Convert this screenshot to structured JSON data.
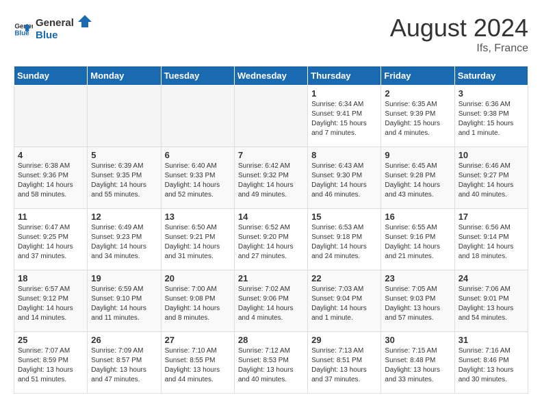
{
  "header": {
    "logo_line1": "General",
    "logo_line2": "Blue",
    "month": "August 2024",
    "location": "Ifs, France"
  },
  "days_of_week": [
    "Sunday",
    "Monday",
    "Tuesday",
    "Wednesday",
    "Thursday",
    "Friday",
    "Saturday"
  ],
  "weeks": [
    [
      {
        "day": "",
        "info": ""
      },
      {
        "day": "",
        "info": ""
      },
      {
        "day": "",
        "info": ""
      },
      {
        "day": "",
        "info": ""
      },
      {
        "day": "1",
        "info": "Sunrise: 6:34 AM\nSunset: 9:41 PM\nDaylight: 15 hours\nand 7 minutes."
      },
      {
        "day": "2",
        "info": "Sunrise: 6:35 AM\nSunset: 9:39 PM\nDaylight: 15 hours\nand 4 minutes."
      },
      {
        "day": "3",
        "info": "Sunrise: 6:36 AM\nSunset: 9:38 PM\nDaylight: 15 hours\nand 1 minute."
      }
    ],
    [
      {
        "day": "4",
        "info": "Sunrise: 6:38 AM\nSunset: 9:36 PM\nDaylight: 14 hours\nand 58 minutes."
      },
      {
        "day": "5",
        "info": "Sunrise: 6:39 AM\nSunset: 9:35 PM\nDaylight: 14 hours\nand 55 minutes."
      },
      {
        "day": "6",
        "info": "Sunrise: 6:40 AM\nSunset: 9:33 PM\nDaylight: 14 hours\nand 52 minutes."
      },
      {
        "day": "7",
        "info": "Sunrise: 6:42 AM\nSunset: 9:32 PM\nDaylight: 14 hours\nand 49 minutes."
      },
      {
        "day": "8",
        "info": "Sunrise: 6:43 AM\nSunset: 9:30 PM\nDaylight: 14 hours\nand 46 minutes."
      },
      {
        "day": "9",
        "info": "Sunrise: 6:45 AM\nSunset: 9:28 PM\nDaylight: 14 hours\nand 43 minutes."
      },
      {
        "day": "10",
        "info": "Sunrise: 6:46 AM\nSunset: 9:27 PM\nDaylight: 14 hours\nand 40 minutes."
      }
    ],
    [
      {
        "day": "11",
        "info": "Sunrise: 6:47 AM\nSunset: 9:25 PM\nDaylight: 14 hours\nand 37 minutes."
      },
      {
        "day": "12",
        "info": "Sunrise: 6:49 AM\nSunset: 9:23 PM\nDaylight: 14 hours\nand 34 minutes."
      },
      {
        "day": "13",
        "info": "Sunrise: 6:50 AM\nSunset: 9:21 PM\nDaylight: 14 hours\nand 31 minutes."
      },
      {
        "day": "14",
        "info": "Sunrise: 6:52 AM\nSunset: 9:20 PM\nDaylight: 14 hours\nand 27 minutes."
      },
      {
        "day": "15",
        "info": "Sunrise: 6:53 AM\nSunset: 9:18 PM\nDaylight: 14 hours\nand 24 minutes."
      },
      {
        "day": "16",
        "info": "Sunrise: 6:55 AM\nSunset: 9:16 PM\nDaylight: 14 hours\nand 21 minutes."
      },
      {
        "day": "17",
        "info": "Sunrise: 6:56 AM\nSunset: 9:14 PM\nDaylight: 14 hours\nand 18 minutes."
      }
    ],
    [
      {
        "day": "18",
        "info": "Sunrise: 6:57 AM\nSunset: 9:12 PM\nDaylight: 14 hours\nand 14 minutes."
      },
      {
        "day": "19",
        "info": "Sunrise: 6:59 AM\nSunset: 9:10 PM\nDaylight: 14 hours\nand 11 minutes."
      },
      {
        "day": "20",
        "info": "Sunrise: 7:00 AM\nSunset: 9:08 PM\nDaylight: 14 hours\nand 8 minutes."
      },
      {
        "day": "21",
        "info": "Sunrise: 7:02 AM\nSunset: 9:06 PM\nDaylight: 14 hours\nand 4 minutes."
      },
      {
        "day": "22",
        "info": "Sunrise: 7:03 AM\nSunset: 9:04 PM\nDaylight: 14 hours\nand 1 minute."
      },
      {
        "day": "23",
        "info": "Sunrise: 7:05 AM\nSunset: 9:03 PM\nDaylight: 13 hours\nand 57 minutes."
      },
      {
        "day": "24",
        "info": "Sunrise: 7:06 AM\nSunset: 9:01 PM\nDaylight: 13 hours\nand 54 minutes."
      }
    ],
    [
      {
        "day": "25",
        "info": "Sunrise: 7:07 AM\nSunset: 8:59 PM\nDaylight: 13 hours\nand 51 minutes."
      },
      {
        "day": "26",
        "info": "Sunrise: 7:09 AM\nSunset: 8:57 PM\nDaylight: 13 hours\nand 47 minutes."
      },
      {
        "day": "27",
        "info": "Sunrise: 7:10 AM\nSunset: 8:55 PM\nDaylight: 13 hours\nand 44 minutes."
      },
      {
        "day": "28",
        "info": "Sunrise: 7:12 AM\nSunset: 8:53 PM\nDaylight: 13 hours\nand 40 minutes."
      },
      {
        "day": "29",
        "info": "Sunrise: 7:13 AM\nSunset: 8:51 PM\nDaylight: 13 hours\nand 37 minutes."
      },
      {
        "day": "30",
        "info": "Sunrise: 7:15 AM\nSunset: 8:48 PM\nDaylight: 13 hours\nand 33 minutes."
      },
      {
        "day": "31",
        "info": "Sunrise: 7:16 AM\nSunset: 8:46 PM\nDaylight: 13 hours\nand 30 minutes."
      }
    ]
  ]
}
